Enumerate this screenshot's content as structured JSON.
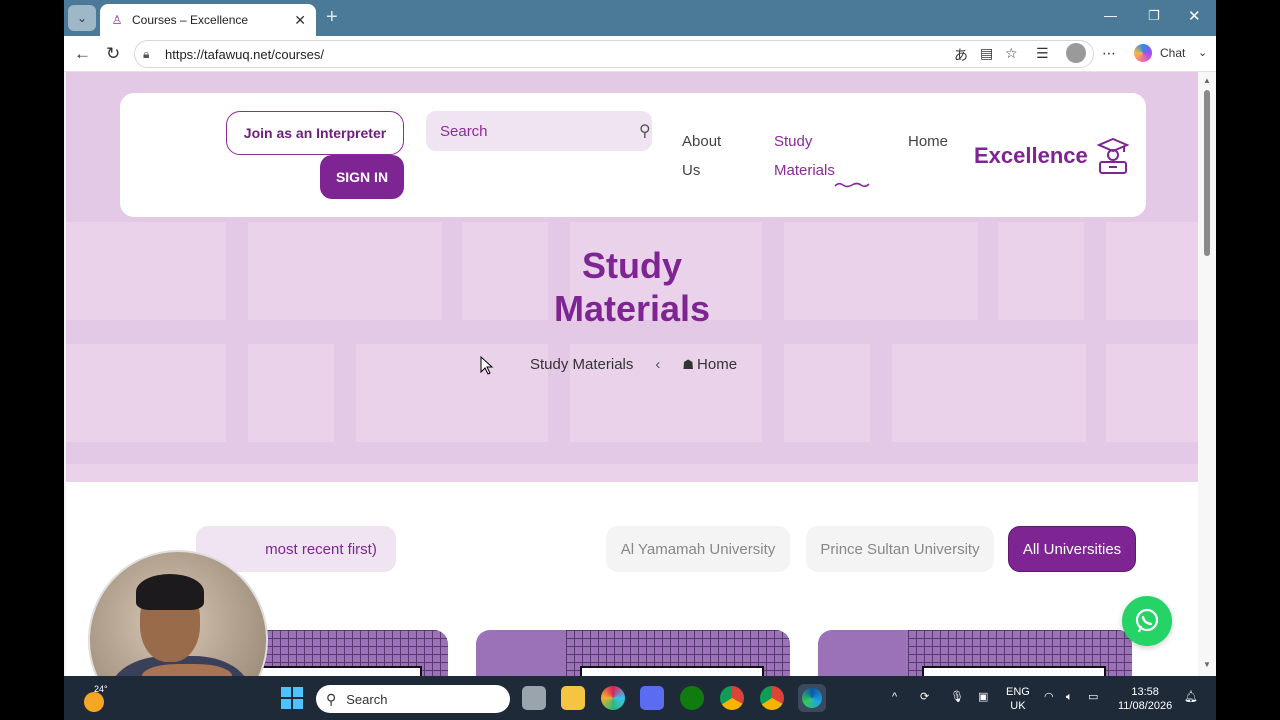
{
  "browser": {
    "tab_title": "Courses – Excellence",
    "url": "https://tafawuq.net/courses/",
    "chat_label": "Chat"
  },
  "site": {
    "join_button": "Join as an Interpreter",
    "signin_button": "SIGN IN",
    "search_placeholder": "Search",
    "nav": {
      "about_line1": "About",
      "about_line2": "Us",
      "study_line1": "Study",
      "study_line2": "Materials",
      "home": "Home"
    },
    "logo_text": "Excellence",
    "hero_title_line1": "Study",
    "hero_title_line2": "Materials",
    "breadcrumb": {
      "current": "Study Materials",
      "home": "Home"
    },
    "filters": {
      "sort": "most recent first)",
      "al_yamamah": "Al Yamamah University",
      "prince_sultan": "Prince Sultan University",
      "all": "All Universities"
    },
    "accent_color": "#7e2493"
  },
  "taskbar": {
    "weather_temp": "24°",
    "search_label": "Search",
    "lang_line1": "ENG",
    "lang_line2": "UK",
    "time": "13:58",
    "date": "11/08/2026"
  }
}
